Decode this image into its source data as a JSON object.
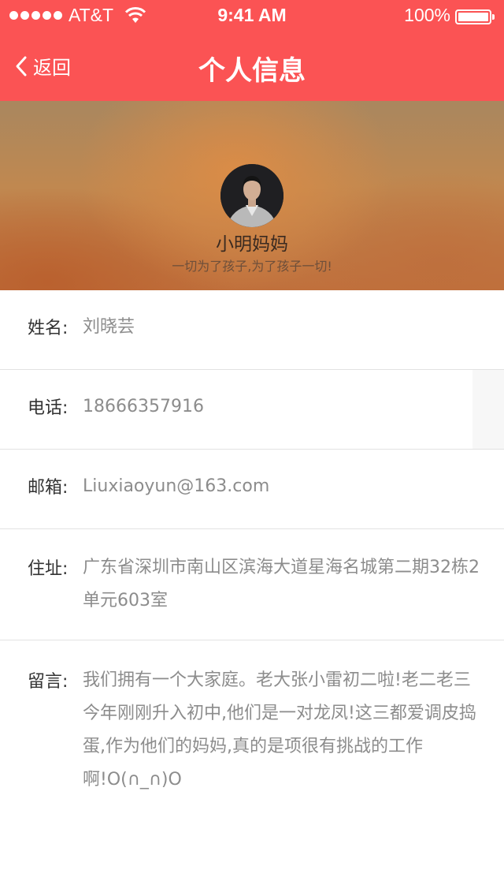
{
  "status_bar": {
    "carrier": "AT&T",
    "time": "9:41 AM",
    "battery": "100%"
  },
  "nav": {
    "back_label": "返回",
    "title": "个人信息"
  },
  "profile": {
    "nickname": "小明妈妈",
    "motto": "一切为了孩子,为了孩子一切!"
  },
  "fields": {
    "name": {
      "label": "姓名:",
      "value": "刘晓芸"
    },
    "phone": {
      "label": "电话:",
      "value": "18666357916"
    },
    "email": {
      "label": "邮箱:",
      "value": "Liuxiaoyun@163.com"
    },
    "address": {
      "label": "住址:",
      "value": "广东省深圳市南山区滨海大道星海名城第二期32栋2单元603室"
    },
    "message": {
      "label": "留言:",
      "value": "我们拥有一个大家庭。老大张小雷初二啦!老二老三今年刚刚升入初中,他们是一对龙凤!这三都爱调皮捣蛋,作为他们的妈妈,真的是项很有挑战的工作啊!O(∩_∩)O"
    }
  },
  "colors": {
    "header_bg": "#fb5354",
    "label_text": "#333333",
    "value_text": "#8c8c8c"
  }
}
